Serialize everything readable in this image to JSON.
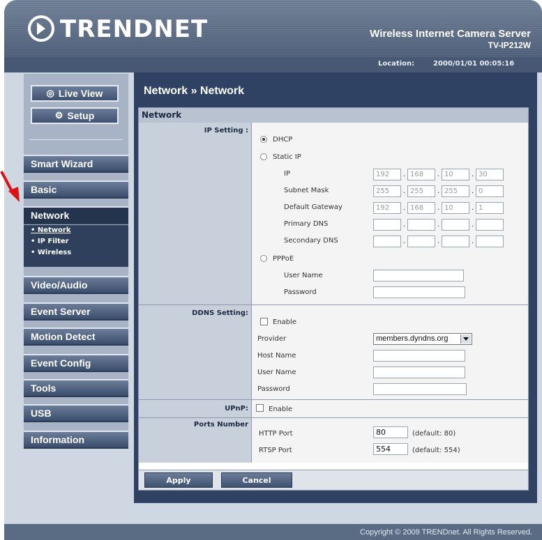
{
  "header": {
    "logo": "TRENDNET",
    "title": "Wireless Internet Camera Server",
    "model": "TV-IP212W",
    "location_label": "Location:",
    "location_value": "2000/01/01 00:05:16"
  },
  "sidebar": {
    "live_view": "Live View",
    "setup": "Setup",
    "items": [
      "Smart Wizard",
      "Basic",
      "Network",
      "Video/Audio",
      "Event Server",
      "Motion Detect",
      "Event Config",
      "Tools",
      "USB",
      "Information"
    ],
    "subitems": [
      "Network",
      "IP Filter",
      "Wireless"
    ]
  },
  "content": {
    "title": "Network » Network",
    "panel_title": "Network",
    "ip_setting_label": "IP Setting :",
    "dhcp": "DHCP",
    "static_ip": "Static IP",
    "ip_label": "IP",
    "ip": [
      "192",
      "168",
      "10",
      "30"
    ],
    "subnet_label": "Subnet Mask",
    "subnet": [
      "255",
      "255",
      "255",
      "0"
    ],
    "gateway_label": "Default Gateway",
    "gateway": [
      "192",
      "168",
      "10",
      "1"
    ],
    "primary_dns_label": "Primary DNS",
    "secondary_dns_label": "Secondary DNS",
    "pppoe": "PPPoE",
    "user_name_label": "User Name",
    "password_label": "Password",
    "ddns_label": "DDNS Setting:",
    "ddns_enable": "Enable",
    "provider_label": "Provider",
    "provider_value": "members.dyndns.org",
    "host_name_label": "Host Name",
    "ddns_user_label": "User Name",
    "ddns_password_label": "Password",
    "upnp_label": "UPnP:",
    "upnp_enable": "Enable",
    "ports_label": "Ports Number",
    "http_port_label": "HTTP Port",
    "http_port": "80",
    "http_default": "(default: 80)",
    "rtsp_port_label": "RTSP Port",
    "rtsp_port": "554",
    "rtsp_default": "(default: 554)",
    "apply": "Apply",
    "cancel": "Cancel"
  },
  "footer": "Copyright © 2009 TRENDnet. All Rights Reserved.",
  "colors": {
    "header": "#4d5e78",
    "content_bg": "#2f4263",
    "active_nav": "#25344d",
    "arrow": "#e01010"
  }
}
